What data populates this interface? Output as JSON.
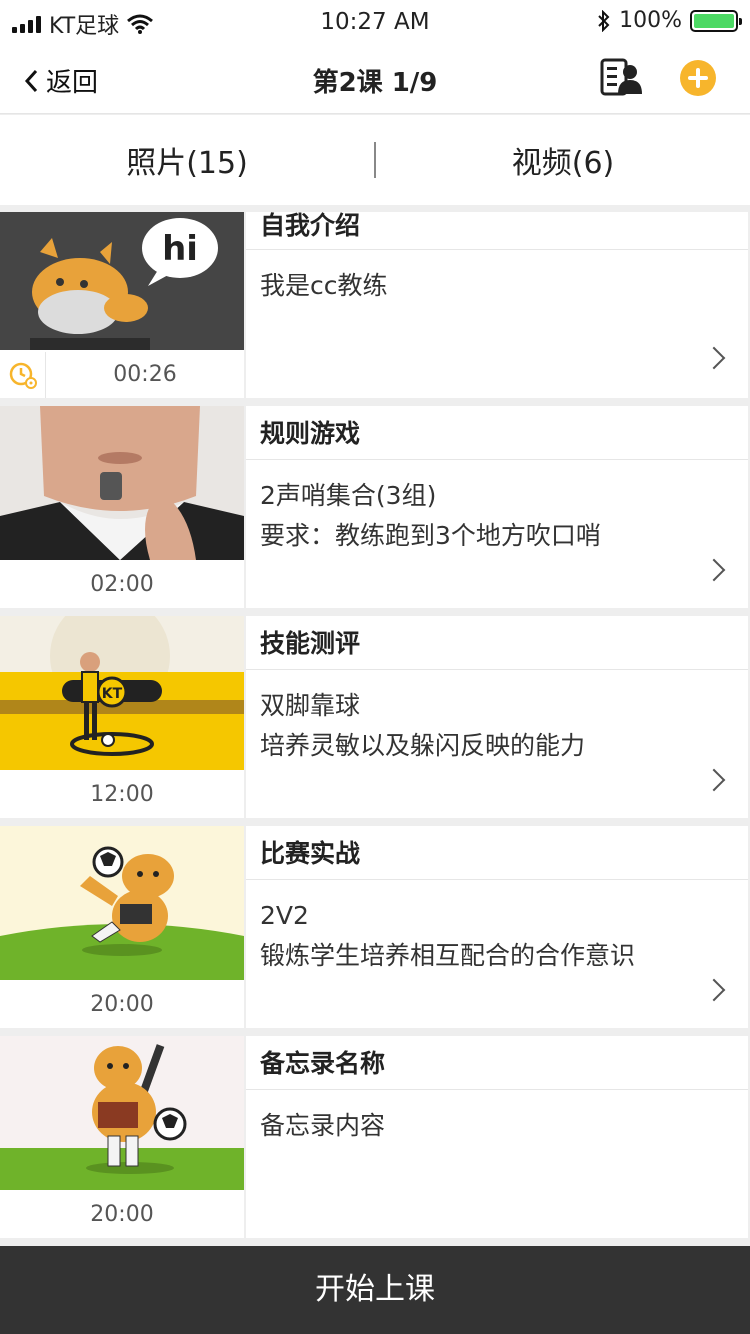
{
  "status": {
    "carrier": "KT足球",
    "time": "10:27 AM",
    "battery": "100%",
    "battery_level": 1.0
  },
  "nav": {
    "back_label": "返回",
    "title": "第2课 1/9"
  },
  "tabs": [
    {
      "label": "照片(15)"
    },
    {
      "label": "视频(6)"
    }
  ],
  "lessons": [
    {
      "title": "自我介绍",
      "desc": [
        "我是cc教练"
      ],
      "duration": "00:26"
    },
    {
      "title": "规则游戏",
      "desc": [
        "2声哨集合(3组)",
        "要求：教练跑到3个地方吹口哨"
      ],
      "duration": "02:00"
    },
    {
      "title": "技能测评",
      "desc": [
        "双脚靠球",
        "培养灵敏以及躲闪反映的能力"
      ],
      "duration": "12:00"
    },
    {
      "title": "比赛实战",
      "desc": [
        "2V2",
        "锻炼学生培养相互配合的合作意识"
      ],
      "duration": "20:00"
    },
    {
      "title": "备忘录名称",
      "desc": [
        "备忘录内容"
      ],
      "duration": "20:00"
    }
  ],
  "bubble_text": "hi",
  "badge_text": "KT",
  "start_button": "开始上课",
  "colors": {
    "accent": "#f7b52c",
    "bottom_bar": "#333333",
    "battery": "#4cd964"
  }
}
